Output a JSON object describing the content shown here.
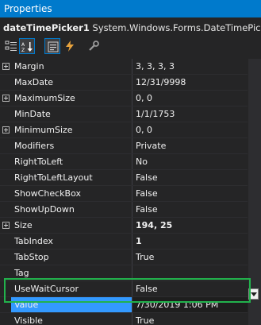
{
  "window": {
    "title": "Properties"
  },
  "object": {
    "name": "dateTimePicker1",
    "type": "System.Windows.Forms.DateTimePicker"
  },
  "toolbar": {
    "buttons": [
      "categorized-icon",
      "alphabetical-icon",
      "properties-icon",
      "events-icon",
      "property-pages-icon"
    ]
  },
  "properties": [
    {
      "name": "Margin",
      "value": "3, 3, 3, 3",
      "expandable": true
    },
    {
      "name": "MaxDate",
      "value": "12/31/9998"
    },
    {
      "name": "MaximumSize",
      "value": "0, 0",
      "expandable": true
    },
    {
      "name": "MinDate",
      "value": "1/1/1753"
    },
    {
      "name": "MinimumSize",
      "value": "0, 0",
      "expandable": true
    },
    {
      "name": "Modifiers",
      "value": "Private"
    },
    {
      "name": "RightToLeft",
      "value": "No"
    },
    {
      "name": "RightToLeftLayout",
      "value": "False"
    },
    {
      "name": "ShowCheckBox",
      "value": "False"
    },
    {
      "name": "ShowUpDown",
      "value": "False"
    },
    {
      "name": "Size",
      "value": "194, 25",
      "expandable": true,
      "bold": true
    },
    {
      "name": "TabIndex",
      "value": "1",
      "bold": true
    },
    {
      "name": "TabStop",
      "value": "True"
    },
    {
      "name": "Tag",
      "value": ""
    },
    {
      "name": "UseWaitCursor",
      "value": "False"
    },
    {
      "name": "Value",
      "value": "7/30/2019 1:06 PM",
      "selected": true
    },
    {
      "name": "Visible",
      "value": "True"
    }
  ],
  "colors": {
    "accent": "#007acc",
    "selection": "#3399ff",
    "highlight_box": "#22b24c",
    "background": "#252526"
  }
}
